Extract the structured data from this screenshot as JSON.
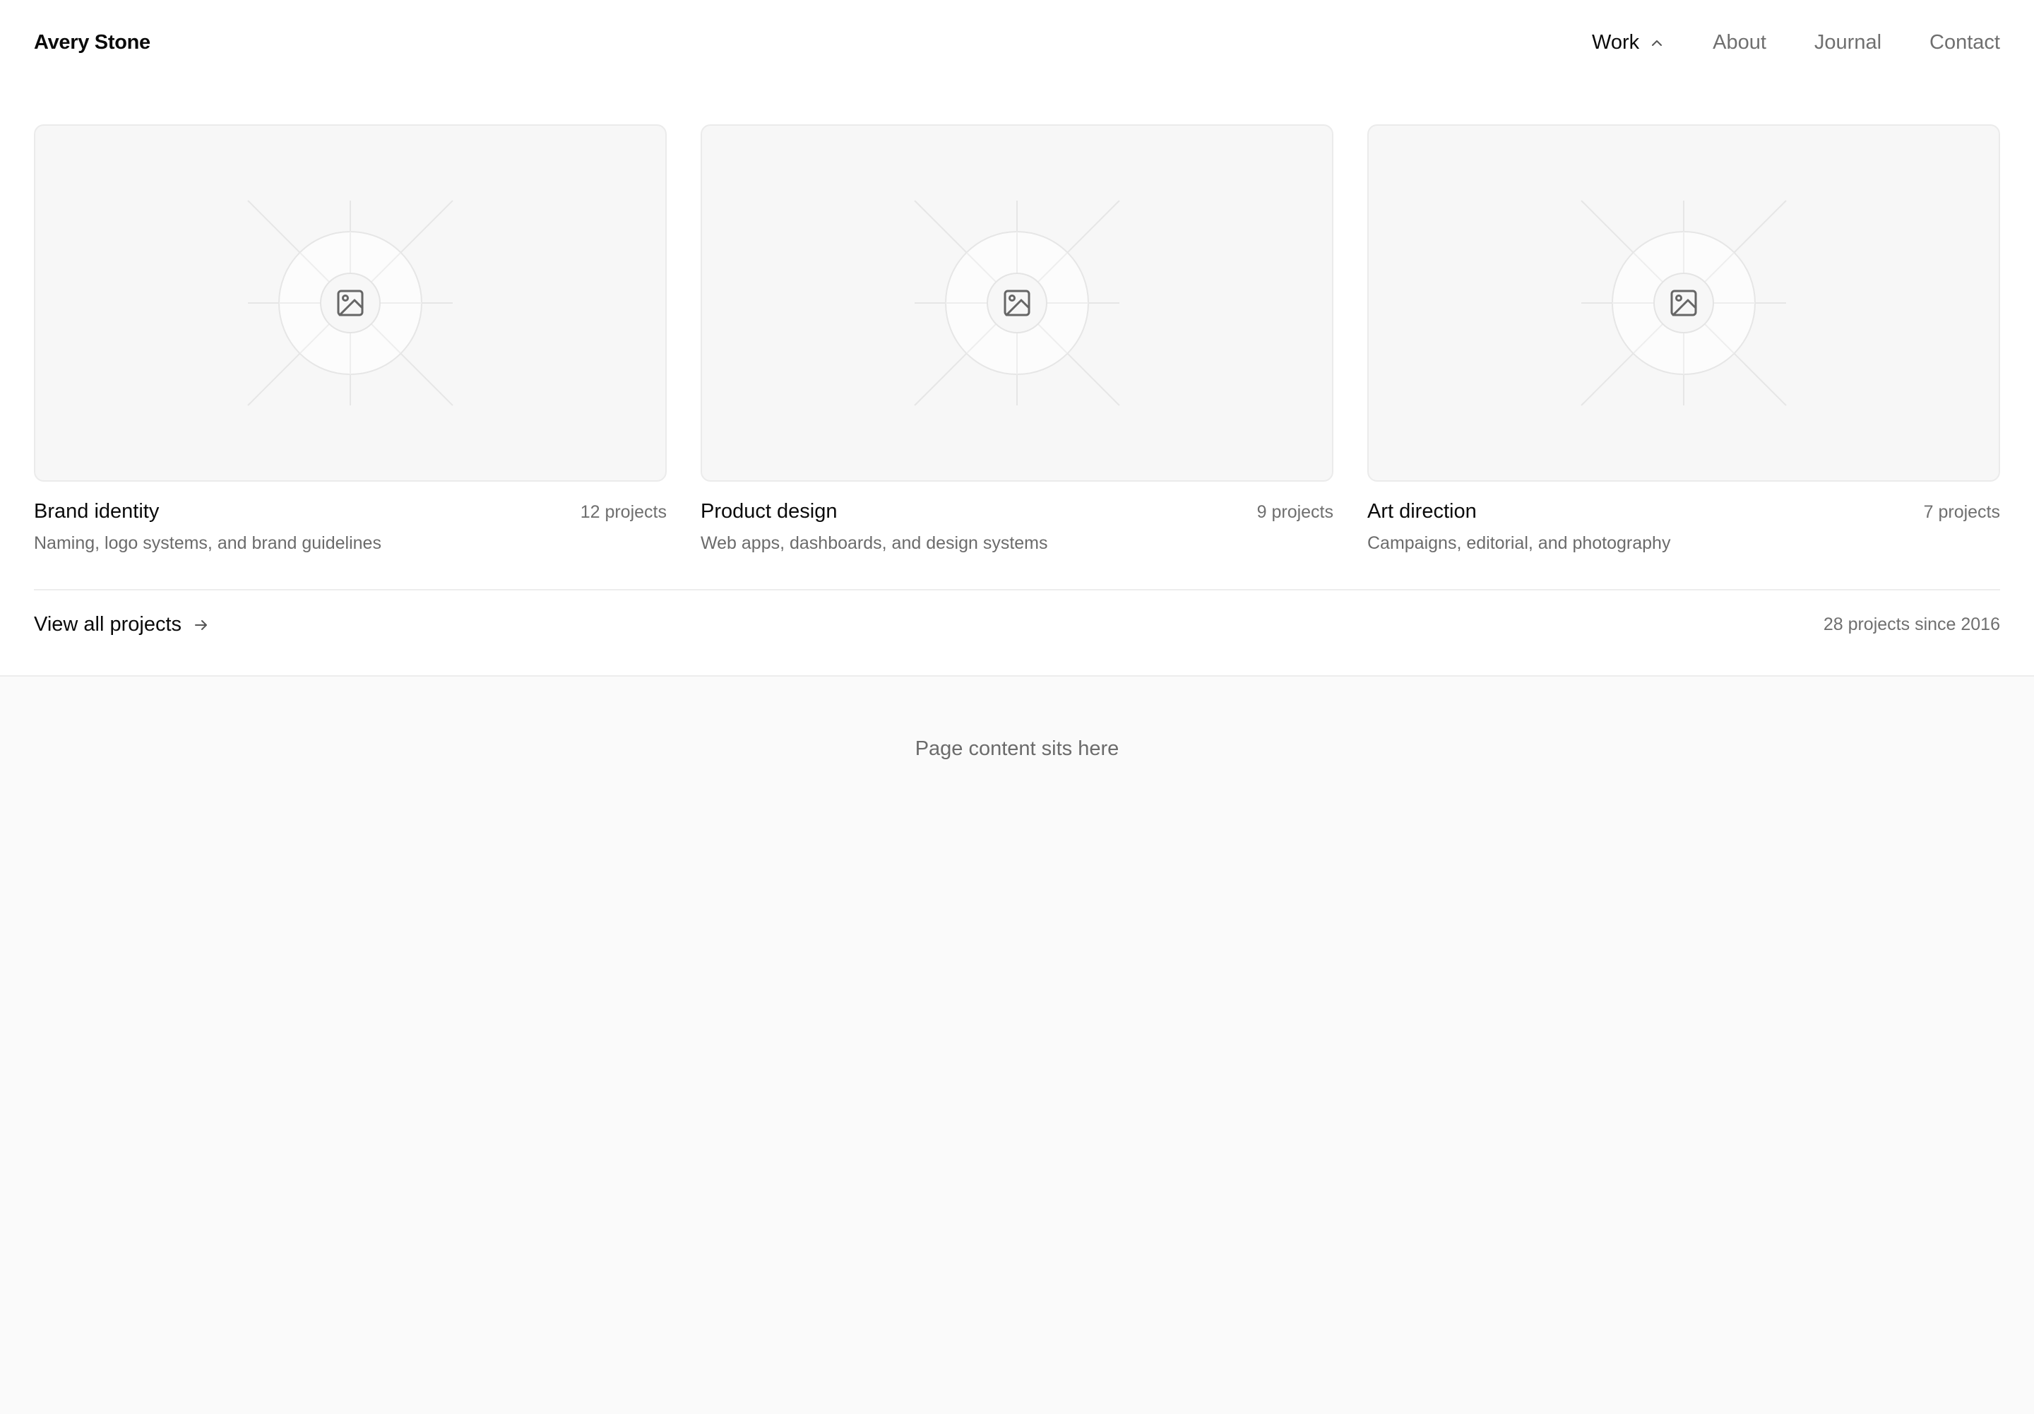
{
  "brand": {
    "name": "Avery Stone"
  },
  "nav": {
    "items": [
      {
        "label": "Work",
        "active": true,
        "expanded": true
      },
      {
        "label": "About"
      },
      {
        "label": "Journal"
      },
      {
        "label": "Contact"
      }
    ]
  },
  "cards": [
    {
      "title": "Brand identity",
      "count": "12 projects",
      "description": "Naming, logo systems, and brand guidelines",
      "icon": "image-icon"
    },
    {
      "title": "Product design",
      "count": "9 projects",
      "description": "Web apps, dashboards, and design systems",
      "icon": "image-icon"
    },
    {
      "title": "Art direction",
      "count": "7 projects",
      "description": "Campaigns, editorial, and photography",
      "icon": "image-icon"
    }
  ],
  "footer": {
    "view_all": "View all projects",
    "summary": "28 projects since 2016"
  },
  "page": {
    "placeholder": "Page content sits here"
  },
  "colors": {
    "text": "#0a0a0a",
    "muted": "#6f6f6f",
    "border": "#ebebeb",
    "thumb_bg": "#f7f7f7",
    "page_bg": "#fafafa"
  }
}
